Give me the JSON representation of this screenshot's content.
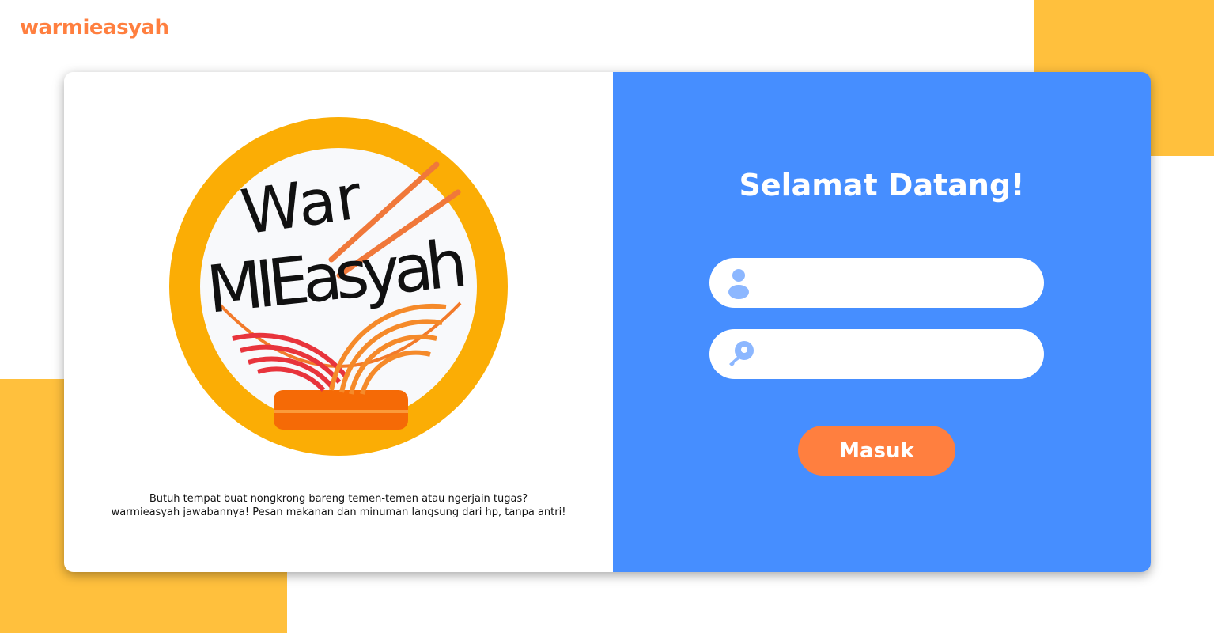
{
  "brand": {
    "name": "warmieasyah"
  },
  "logo": {
    "text_line1": "War",
    "text_line2": "MIEasyah"
  },
  "intro": {
    "line1": "Butuh tempat buat nongkrong bareng temen-temen atau ngerjain tugas?",
    "line2": "warmieasyah jawabannya! Pesan makanan dan minuman langsung dari hp, tanpa antri!"
  },
  "login": {
    "title": "Selamat Datang!",
    "username": {
      "value": "",
      "icon": "user-icon"
    },
    "password": {
      "value": "",
      "icon": "key-icon"
    },
    "submit_label": "Masuk"
  },
  "colors": {
    "accent": "#ff7f3f",
    "panel": "#468eff",
    "decor": "#ffc03d",
    "logo_ring": "#fbad05"
  }
}
